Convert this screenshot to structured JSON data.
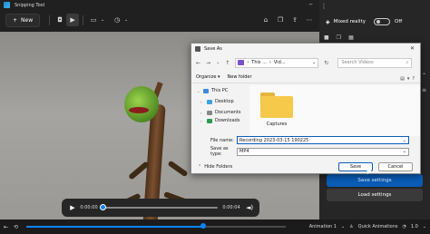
{
  "app": {
    "title": "Snipping Tool"
  },
  "toolbar": {
    "new_label": "New"
  },
  "player": {
    "current_time": "0:00:00",
    "total_time": "0:00:04",
    "progress": 0.0
  },
  "status_bar": {
    "animation_label": "Animation 1",
    "quick_animations_label": "Quick Animations",
    "speed": "1.0",
    "progress": 0.68
  },
  "right_panel": {
    "mixed_reality_label": "Mixed reality",
    "toggle_state": "Off",
    "save_settings": "Save settings",
    "load_settings": "Load settings"
  },
  "dialog": {
    "title": "Save As",
    "address": {
      "seg1": "This ...",
      "seg2": "Vid..."
    },
    "search_placeholder": "Search Videos",
    "organize": "Organize",
    "new_folder": "New folder",
    "tree": [
      {
        "label": "This PC",
        "color": "#3a8be0"
      },
      {
        "label": "Desktop",
        "color": "#3aa3e0"
      },
      {
        "label": "Documents",
        "color": "#888888"
      },
      {
        "label": "Downloads",
        "color": "#2b9c4f"
      }
    ],
    "folder_name": "Captures",
    "file_name_label": "File name:",
    "file_name_value": "Recording 2023-03-15 190225",
    "save_type_label": "Save as type:",
    "save_type_value": "MP4",
    "hide_folders": "Hide Folders",
    "save_button": "Save",
    "cancel_button": "Cancel"
  }
}
